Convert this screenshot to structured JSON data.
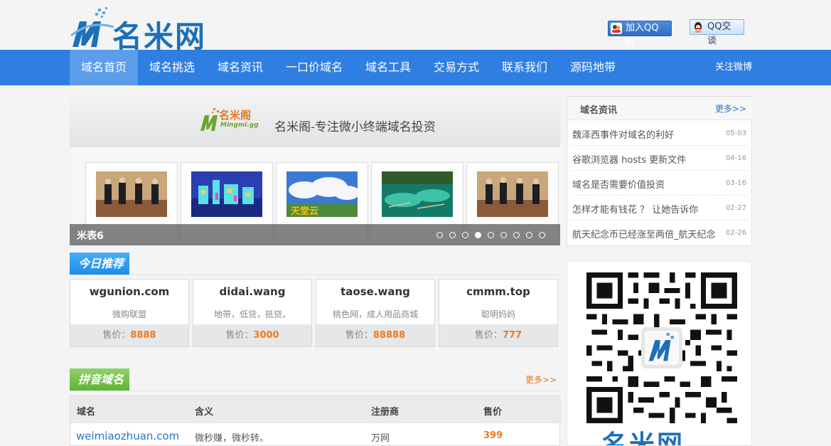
{
  "header": {
    "logo_text": "名米网",
    "qq_join": "加入QQ群",
    "qq_chat": "QQ交谈"
  },
  "nav": {
    "items": [
      {
        "label": "域名首页",
        "active": true
      },
      {
        "label": "域名挑选"
      },
      {
        "label": "域名资讯"
      },
      {
        "label": "一口价域名"
      },
      {
        "label": "域名工具"
      },
      {
        "label": "交易方式"
      },
      {
        "label": "联系我们"
      },
      {
        "label": "源码地带"
      }
    ],
    "weibo": "关注微博"
  },
  "banner": {
    "logo_text": "名米阁",
    "logo_sub": "Mingmi.gg",
    "slogan": "名米阁-专注微小终端域名投资",
    "caption": "米表6",
    "slide_count": 9,
    "active_slide": 4,
    "thumb_overlay_text": "天堂云"
  },
  "recommend": {
    "title": "今日推荐",
    "price_label": "售价：",
    "cards": [
      {
        "domain": "wgunion.com",
        "desc": "微购联盟",
        "price": "8888"
      },
      {
        "domain": "didai.wang",
        "desc": "地带，低贷，抵贷。",
        "price": "3000"
      },
      {
        "domain": "taose.wang",
        "desc": "桃色网，成人用品商城",
        "price": "88888"
      },
      {
        "domain": "cmmm.top",
        "desc": "聪明妈妈",
        "price": "777"
      }
    ]
  },
  "pinyin": {
    "title": "拼音域名",
    "more": "更多>>",
    "columns": [
      "域名",
      "含义",
      "注册商",
      "售价"
    ],
    "rows": [
      {
        "domain": "weimiaozhuan.com",
        "meaning": "微秒赚，微秒转。",
        "registrar": "万网",
        "price": "399"
      }
    ]
  },
  "news": {
    "title": "域名资讯",
    "more": "更多>>",
    "items": [
      {
        "title": "魏泽西事件对域名的利好",
        "date": "05-03"
      },
      {
        "title": "谷歌浏览器 hosts 更新文件",
        "date": "04-16"
      },
      {
        "title": "域名是否需要价值投资",
        "date": "03-16"
      },
      {
        "title": "怎样才能有钱花 ？ 让她告诉你",
        "date": "02-27"
      },
      {
        "title": "航天纪念币已经涨至两倍_航天纪念",
        "date": "02-26"
      }
    ]
  },
  "qr": {
    "caption": "名米网"
  },
  "colors": {
    "nav_bg": "#2f7fe3",
    "nav_active": "#5b9dea",
    "brand_blue": "#1d6fb8",
    "price_orange": "#f07a17",
    "tab_blue": "#1d8ce9",
    "tab_green": "#5db431"
  }
}
